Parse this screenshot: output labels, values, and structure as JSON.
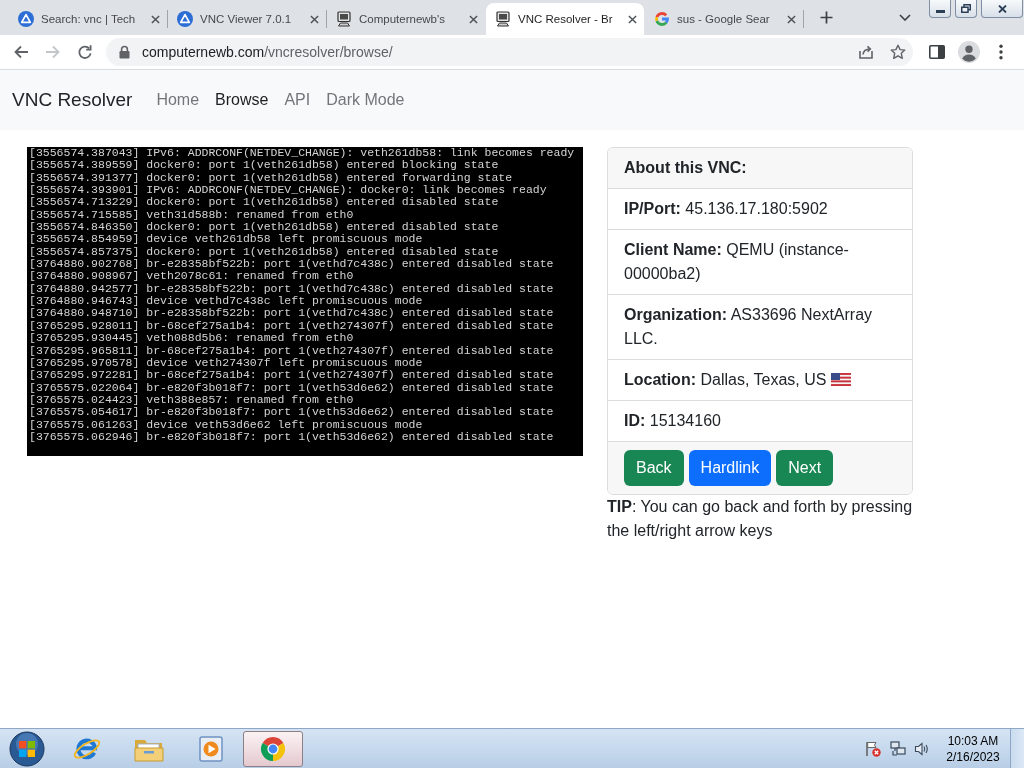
{
  "tabs": [
    {
      "title": "Search: vnc | Tech",
      "kind": "circle",
      "selected": false
    },
    {
      "title": "VNC Viewer 7.0.1",
      "kind": "circle",
      "selected": false
    },
    {
      "title": "Computernewb's",
      "kind": "computer",
      "selected": false
    },
    {
      "title": "VNC Resolver - Br",
      "kind": "computer",
      "selected": true
    },
    {
      "title": "sus - Google Sear",
      "kind": "google",
      "selected": false
    }
  ],
  "address_bar": {
    "host": "computernewb.com",
    "path": "/vncresolver/browse/"
  },
  "navbar": {
    "brand": "VNC Resolver",
    "links": [
      {
        "label": "Home",
        "selected": false
      },
      {
        "label": "Browse",
        "selected": true
      },
      {
        "label": "API",
        "selected": false
      },
      {
        "label": "Dark Mode",
        "selected": false
      }
    ]
  },
  "terminal": {
    "lines": [
      "[3556574.387043] IPv6: ADDRCONF(NETDEV_CHANGE): veth261db58: link becomes ready",
      "[3556574.389559] docker0: port 1(veth261db58) entered blocking state",
      "[3556574.391377] docker0: port 1(veth261db58) entered forwarding state",
      "[3556574.393901] IPv6: ADDRCONF(NETDEV_CHANGE): docker0: link becomes ready",
      "[3556574.713229] docker0: port 1(veth261db58) entered disabled state",
      "[3556574.715585] veth31d588b: renamed from eth0",
      "[3556574.846350] docker0: port 1(veth261db58) entered disabled state",
      "[3556574.854959] device veth261db58 left promiscuous mode",
      "[3556574.857375] docker0: port 1(veth261db58) entered disabled state",
      "[3764880.902768] br-e28358bf522b: port 1(vethd7c438c) entered disabled state",
      "[3764880.908967] veth2078c61: renamed from eth0",
      "[3764880.942577] br-e28358bf522b: port 1(vethd7c438c) entered disabled state",
      "[3764880.946743] device vethd7c438c left promiscuous mode",
      "[3764880.948710] br-e28358bf522b: port 1(vethd7c438c) entered disabled state",
      "[3765295.928011] br-68cef275a1b4: port 1(veth274307f) entered disabled state",
      "[3765295.930445] veth088d5b6: renamed from eth0",
      "[3765295.965811] br-68cef275a1b4: port 1(veth274307f) entered disabled state",
      "[3765295.970578] device veth274307f left promiscuous mode",
      "[3765295.972281] br-68cef275a1b4: port 1(veth274307f) entered disabled state",
      "[3765575.022064] br-e820f3b018f7: port 1(veth53d6e62) entered disabled state",
      "[3765575.024423] veth388e857: renamed from eth0",
      "[3765575.054617] br-e820f3b018f7: port 1(veth53d6e62) entered disabled state",
      "[3765575.061263] device veth53d6e62 left promiscuous mode",
      "[3765575.062946] br-e820f3b018f7: port 1(veth53d6e62) entered disabled state"
    ]
  },
  "card": {
    "header": "About this VNC:",
    "rows": [
      {
        "kind": "plain",
        "text": "**IP/Port:** 45.136.17.180:5902"
      },
      {
        "kind": "plain",
        "text": "**Client Name:** QEMU (instance-00000ba2)"
      },
      {
        "kind": "plain",
        "text": "**Organization:** AS33696 NextArray LLC."
      },
      {
        "kind": "flag",
        "text": "**Location:** Dallas, Texas, US"
      },
      {
        "kind": "plain",
        "text": "**ID:** 15134160"
      }
    ],
    "buttons": [
      {
        "label": "Back",
        "color": "#198754"
      },
      {
        "label": "Hardlink",
        "color": "#0d6efd"
      },
      {
        "label": "Next",
        "color": "#198754"
      }
    ]
  },
  "tip": "**TIP**: You can go back and forth by pressing the left/right arrow keys",
  "taskbar": {
    "apps": [
      {
        "kind": "ie",
        "selected": false
      },
      {
        "kind": "folder",
        "selected": false
      },
      {
        "kind": "player",
        "selected": false
      },
      {
        "kind": "chrome",
        "selected": true
      }
    ],
    "time": "10:03 AM",
    "date": "2/16/2023"
  }
}
